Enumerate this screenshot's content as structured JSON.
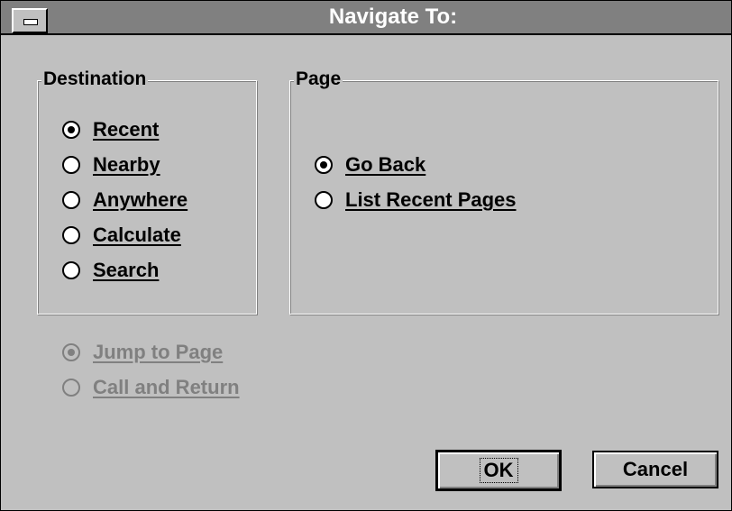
{
  "window": {
    "title": "Navigate To:"
  },
  "destination": {
    "label": "Destination",
    "options": [
      {
        "label": "Recent",
        "checked": true
      },
      {
        "label": "Nearby",
        "checked": false
      },
      {
        "label": "Anywhere",
        "checked": false
      },
      {
        "label": "Calculate",
        "checked": false
      },
      {
        "label": "Search",
        "checked": false
      }
    ]
  },
  "page": {
    "label": "Page",
    "options": [
      {
        "label": "Go Back",
        "checked": true
      },
      {
        "label": "List Recent Pages",
        "checked": false
      }
    ]
  },
  "mode": {
    "options": [
      {
        "label": "Jump to Page",
        "checked": true,
        "disabled": true
      },
      {
        "label": "Call and Return",
        "checked": false,
        "disabled": true
      }
    ]
  },
  "buttons": {
    "ok": "OK",
    "cancel": "Cancel"
  }
}
